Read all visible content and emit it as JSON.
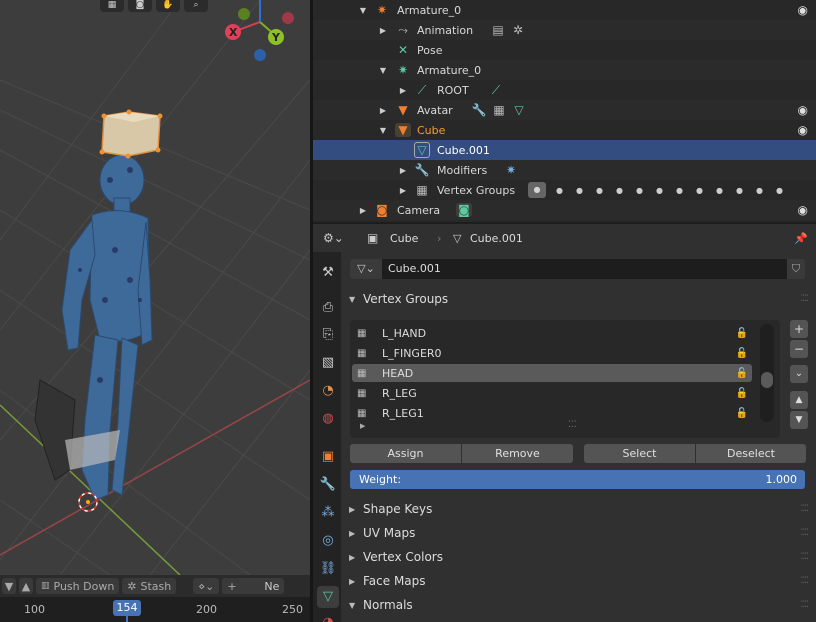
{
  "viewport": {
    "gizmo": {
      "x_label": "X",
      "y_label": "Y"
    }
  },
  "timeline": {
    "push_down": "Push Down",
    "stash": "Stash",
    "new_cut": "Ne",
    "ticks": [
      "100",
      "200",
      "250"
    ],
    "current_frame": "154"
  },
  "outliner": {
    "rows": [
      {
        "label": "Armature_0",
        "icon": "armature-icon"
      },
      {
        "label": "Animation",
        "icon": "animation-icon"
      },
      {
        "label": "Pose",
        "icon": "pose-icon"
      },
      {
        "label": "Armature_0",
        "icon": "armature-data-icon"
      },
      {
        "label": "ROOT",
        "icon": "bone-icon"
      },
      {
        "label": "Avatar",
        "icon": "mesh-object-icon"
      },
      {
        "label": "Cube",
        "icon": "mesh-object-icon"
      },
      {
        "label": "Cube.001",
        "icon": "mesh-data-icon"
      },
      {
        "label": "Modifiers",
        "icon": "wrench-icon"
      },
      {
        "label": "Vertex Groups",
        "icon": "vertex-groups-icon"
      },
      {
        "label": "Camera",
        "icon": "camera-icon"
      }
    ],
    "active_color": "#f0a030",
    "selected_row_color": "#334d80"
  },
  "properties": {
    "breadcrumb": {
      "object": "Cube",
      "mesh": "Cube.001"
    },
    "mesh_name": "Cube.001",
    "sections": {
      "vertex_groups": "Vertex Groups",
      "shape_keys": "Shape Keys",
      "uv_maps": "UV Maps",
      "vertex_colors": "Vertex Colors",
      "face_maps": "Face Maps",
      "normals": "Normals"
    },
    "vertex_groups": [
      {
        "name": "L_HAND"
      },
      {
        "name": "L_FINGER0"
      },
      {
        "name": "HEAD"
      },
      {
        "name": "R_LEG"
      },
      {
        "name": "R_LEG1"
      }
    ],
    "buttons": {
      "assign": "Assign",
      "remove": "Remove",
      "select": "Select",
      "deselect": "Deselect"
    },
    "weight_label": "Weight:",
    "weight_value": "1.000",
    "accent": "#4772b3"
  }
}
